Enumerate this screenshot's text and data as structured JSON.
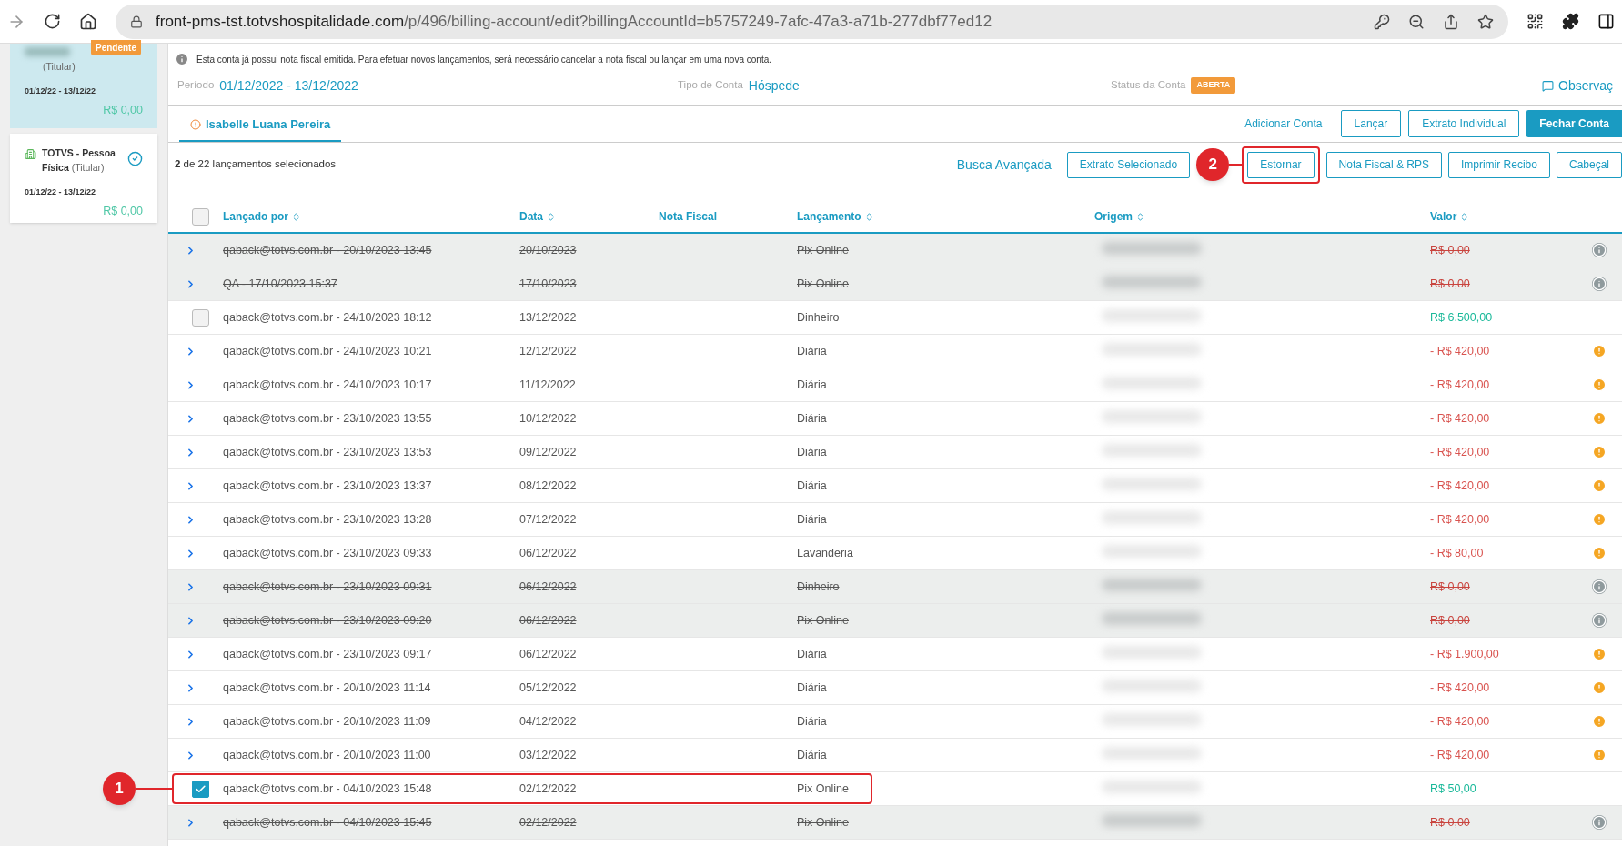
{
  "browser": {
    "url_host": "front-pms-tst.totvshospitalidade.com",
    "url_path": "/p/496/billing-account/edit?billingAccountId=b5757249-7afc-47a3-a71b-277dbf77ed12"
  },
  "accounts": [
    {
      "selected": true,
      "badge": "Pendente",
      "role": "(Titular)",
      "dates": "01/12/22 - 13/12/22",
      "amount": "R$ 0,00",
      "verified": false
    },
    {
      "selected": false,
      "name": "TOTVS - Pessoa Física",
      "role": "(Titular)",
      "dates": "01/12/22 - 13/12/22",
      "amount": "R$ 0,00",
      "verified": true
    }
  ],
  "notice": "Esta conta já possui nota fiscal emitida. Para efetuar novos lançamentos, será necessário cancelar a nota fiscal ou lançar em uma nova conta.",
  "summary": [
    {
      "label": "Período",
      "value": "01/12/2022 - 13/12/2022",
      "kind": "text"
    },
    {
      "label": "Tipo de Conta",
      "value": "Hóspede",
      "kind": "text"
    },
    {
      "label": "Status da Conta",
      "value": "ABERTA",
      "kind": "badge"
    }
  ],
  "observations_link": "Observaç",
  "tabs": [
    {
      "label": "Isabelle Luana Pereira",
      "selected": true,
      "warning": true
    }
  ],
  "account_actions": [
    {
      "label": "Adicionar Conta",
      "kind": "link"
    },
    {
      "label": "Lançar",
      "kind": "outline"
    },
    {
      "label": "Extrato Individual",
      "kind": "outline"
    },
    {
      "label": "Fechar Conta",
      "kind": "primary"
    }
  ],
  "selection_summary": "**2** de 22 lançamentos selecionados",
  "advanced_search": "Busca Avançada",
  "entry_actions": [
    {
      "label": "Extrato Selecionado",
      "highlighted": false
    },
    {
      "label": "Estornar",
      "highlighted": true,
      "callout": "2"
    },
    {
      "label": "Nota Fiscal & RPS",
      "highlighted": false
    },
    {
      "label": "Imprimir Recibo",
      "highlighted": false
    },
    {
      "label": "Cabeçal",
      "highlighted": false
    }
  ],
  "table": {
    "header_checkbox": {
      "checked": false
    },
    "columns": [
      {
        "label": "Lançado por",
        "sortable": true
      },
      {
        "label": "Data",
        "sortable": true
      },
      {
        "label": "Nota Fiscal",
        "sortable": false
      },
      {
        "label": "Lançamento",
        "sortable": true
      },
      {
        "label": "Origem",
        "sortable": true
      },
      {
        "label": "Valor",
        "sortable": true
      }
    ],
    "rows": [
      {
        "kind": "cancelled",
        "expandable": true,
        "posted_by": "qaback@totvs.com.br - 20/10/2023 13:45",
        "date": "20/10/2023",
        "entry": "Pix Online",
        "value": "R$ 0,00"
      },
      {
        "kind": "cancelled",
        "expandable": true,
        "posted_by": "QA - 17/10/2023 15:37",
        "date": "17/10/2023",
        "entry": "Pix Online",
        "value": "R$ 0,00"
      },
      {
        "kind": "credit",
        "expandable": false,
        "checked": false,
        "posted_by": "qaback@totvs.com.br - 24/10/2023 18:12",
        "date": "13/12/2022",
        "entry": "Dinheiro",
        "value": "R$ 6.500,00"
      },
      {
        "kind": "debit",
        "expandable": true,
        "posted_by": "qaback@totvs.com.br - 24/10/2023 10:21",
        "date": "12/12/2022",
        "entry": "Diária",
        "value": "- R$ 420,00"
      },
      {
        "kind": "debit",
        "expandable": true,
        "posted_by": "qaback@totvs.com.br - 24/10/2023 10:17",
        "date": "11/12/2022",
        "entry": "Diária",
        "value": "- R$ 420,00"
      },
      {
        "kind": "debit",
        "expandable": true,
        "posted_by": "qaback@totvs.com.br - 23/10/2023 13:55",
        "date": "10/12/2022",
        "entry": "Diária",
        "value": "- R$ 420,00"
      },
      {
        "kind": "debit",
        "expandable": true,
        "posted_by": "qaback@totvs.com.br - 23/10/2023 13:53",
        "date": "09/12/2022",
        "entry": "Diária",
        "value": "- R$ 420,00"
      },
      {
        "kind": "debit",
        "expandable": true,
        "posted_by": "qaback@totvs.com.br - 23/10/2023 13:37",
        "date": "08/12/2022",
        "entry": "Diária",
        "value": "- R$ 420,00"
      },
      {
        "kind": "debit",
        "expandable": true,
        "posted_by": "qaback@totvs.com.br - 23/10/2023 13:28",
        "date": "07/12/2022",
        "entry": "Diária",
        "value": "- R$ 420,00"
      },
      {
        "kind": "debit",
        "expandable": true,
        "posted_by": "qaback@totvs.com.br - 23/10/2023 09:33",
        "date": "06/12/2022",
        "entry": "Lavanderia",
        "value": "- R$ 80,00"
      },
      {
        "kind": "cancelled",
        "expandable": true,
        "posted_by": "qaback@totvs.com.br - 23/10/2023 09:31",
        "date": "06/12/2022",
        "entry": "Dinheiro",
        "value": "R$ 0,00"
      },
      {
        "kind": "cancelled",
        "expandable": true,
        "posted_by": "qaback@totvs.com.br - 23/10/2023 09:20",
        "date": "06/12/2022",
        "entry": "Pix Online",
        "value": "R$ 0,00"
      },
      {
        "kind": "debit",
        "expandable": true,
        "posted_by": "qaback@totvs.com.br - 23/10/2023 09:17",
        "date": "06/12/2022",
        "entry": "Diária",
        "value": "- R$ 1.900,00"
      },
      {
        "kind": "debit",
        "expandable": true,
        "posted_by": "qaback@totvs.com.br - 20/10/2023 11:14",
        "date": "05/12/2022",
        "entry": "Diária",
        "value": "- R$ 420,00"
      },
      {
        "kind": "debit",
        "expandable": true,
        "posted_by": "qaback@totvs.com.br - 20/10/2023 11:09",
        "date": "04/12/2022",
        "entry": "Diária",
        "value": "- R$ 420,00"
      },
      {
        "kind": "debit",
        "expandable": true,
        "posted_by": "qaback@totvs.com.br - 20/10/2023 11:00",
        "date": "03/12/2022",
        "entry": "Diária",
        "value": "- R$ 420,00"
      },
      {
        "kind": "credit",
        "expandable": false,
        "checked": true,
        "highlighted": true,
        "callout": "1",
        "posted_by": "qaback@totvs.com.br - 04/10/2023 15:48",
        "date": "02/12/2022",
        "entry": "Pix Online",
        "value": "R$ 50,00"
      },
      {
        "kind": "cancelled",
        "expandable": true,
        "posted_by": "qaback@totvs.com.br - 04/10/2023 15:45",
        "date": "02/12/2022",
        "entry": "Pix Online",
        "value": "R$ 0,00"
      }
    ]
  }
}
